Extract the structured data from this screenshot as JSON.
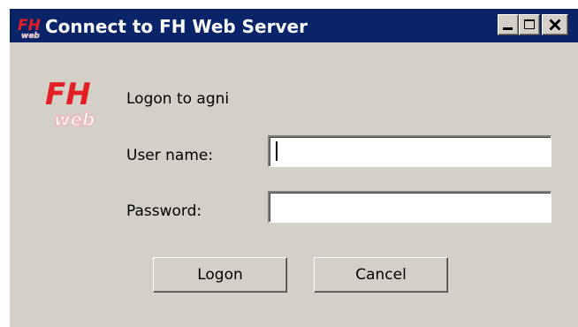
{
  "window": {
    "title": "Connect to FH Web Server",
    "controls": {
      "minimize_icon": "minimize-icon",
      "maximize_icon": "maximize-icon",
      "close_icon": "close-icon"
    }
  },
  "logo": {
    "main_text": "FH",
    "sub_text": "web",
    "primary_color": "#e21e26",
    "secondary_color": "#f2b6b6"
  },
  "dialog": {
    "logon_message": "Logon to agni",
    "username_label": "User name:",
    "username_value": "",
    "password_label": "Password:",
    "password_value": "",
    "logon_button": "Logon",
    "cancel_button": "Cancel"
  },
  "colors": {
    "titlebar": "#0a246a",
    "window_bg": "#d4d0c8"
  }
}
